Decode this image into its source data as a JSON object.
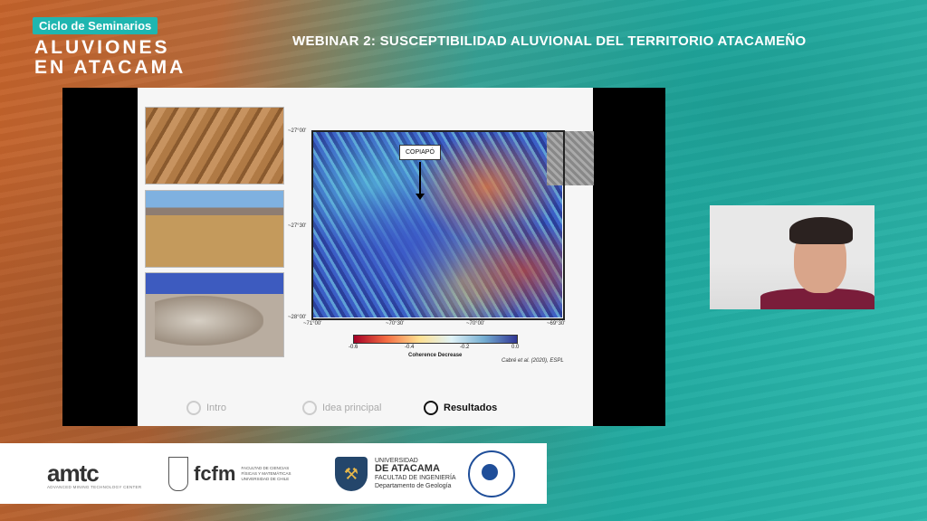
{
  "header": {
    "series_badge": "Ciclo de Seminarios",
    "title_line1": "ALUVIONES",
    "title_line2": "EN ATACAMA",
    "webinar_title": "WEBINAR 2: SUSCEPTIBILIDAD ALUVIONAL DEL TERRITORIO ATACAMEÑO"
  },
  "slide": {
    "map_label": "COPIAPÓ",
    "lat_ticks": [
      "~27°00'",
      "~27°30'",
      "~28°00'"
    ],
    "lon_ticks": [
      "~71°00'",
      "~70°30'",
      "~70°00'",
      "~69°30'"
    ],
    "colorbar_ticks": [
      "-0.6",
      "-0.4",
      "-0.2",
      "0.0"
    ],
    "colorbar_title": "Coherence Decrease",
    "citation": "Cabré et al. (2020), ESPL",
    "nav": [
      {
        "label": "Intro",
        "active": false
      },
      {
        "label": "Idea principal",
        "active": false
      },
      {
        "label": "Resultados",
        "active": true
      }
    ]
  },
  "logos": {
    "amtc_main": "amtc",
    "amtc_sub": "ADVANCED MINING TECHNOLOGY CENTER",
    "fcfm_word": "fcfm",
    "fcfm_sub": "FACULTAD DE CIENCIAS FÍSICAS Y MATEMÁTICAS UNIVERSIDAD DE CHILE",
    "uda_line1": "UNIVERSIDAD",
    "uda_line2": "DE ATACAMA",
    "uda_line3": "FACULTAD DE INGENIERÍA",
    "uda_line4": "Departamento de Geología"
  },
  "colors": {
    "badge": "#1fb6b0",
    "accent_orange": "#c4622a",
    "accent_teal": "#22b3a9"
  }
}
